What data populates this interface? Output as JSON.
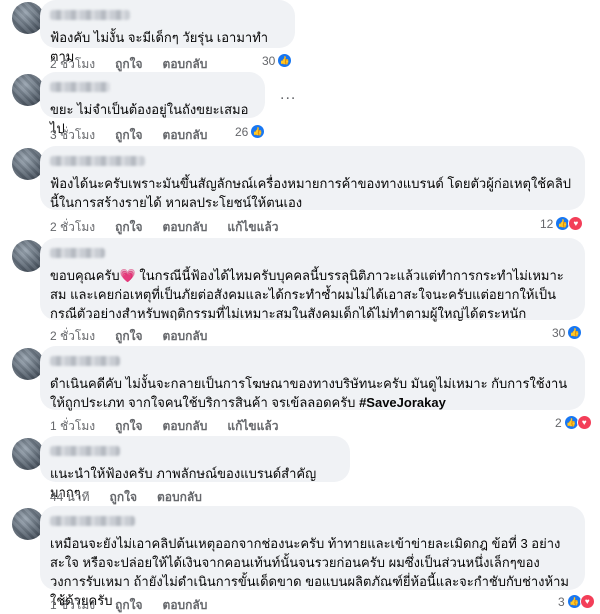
{
  "actions": {
    "like": "ถูกใจ",
    "reply": "ตอบกลับ",
    "translate": "แก้ไขแล้ว"
  },
  "comments": [
    {
      "text": "ฟ้องคับ ไม่งั้น จะมีเด็กๆ วัยรุ่น เอามาทำตาม",
      "time": "2 ชั่วโมง",
      "reactions": "30",
      "edited": false
    },
    {
      "text": "ขยะ ไม่จำเป็นต้องอยู่ในถังขยะเสมอไป",
      "time": "3 ชั่วโมง",
      "reactions": "26",
      "edited": false,
      "more": "..."
    },
    {
      "text": "ฟ้องได้นะครับเพราะมันขึ้นสัญลักษณ์เครื่องหมายการค้าของทางแบรนด์ โดยตัวผู้ก่อเหตุใช้คลิปนี้ในการสร้างรายได้ หาผลประโยชน์ให้ตนเอง",
      "time": "2 ชั่วโมง",
      "reactions": "12",
      "edited": true
    },
    {
      "text": "ขอบคุณครับ💗 ในกรณีนี้ฟ้องได้ไหมครับบุคคลนี้บรรลุนิติภาวะแล้วแต่ทำการกระทำไม่เหมาะสม และเคยก่อเหตุที่เป็นภัยต่อสังคมและได้กระทำซ้ำผมไม่ได้เอาสะใจนะครับแต่อยากให้เป็นกรณีตัวอย่างสำหรับพฤติกรรมที่ไม่เหมาะสมในสังคมเด็กได้ไม่ทำตามผู้ใหญ่ได้ตระหนัก",
      "time": "2 ชั่วโมง",
      "reactions": "30",
      "edited": false
    },
    {
      "text": "ดำเนินคดีคับ ไม่งั้นจะกลายเป็นการโฆษณาของทางบริษัทนะครับ มันดูไม่เหมาะ กับการใช้งานให้ถูกประเภท จากใจคนใช้บริการสินค้า จรเข้ลลอดครับ",
      "hashtag": "#SaveJorakay",
      "time": "1 ชั่วโมง",
      "reactions": "2",
      "edited": true
    },
    {
      "text": "แนะนำให้ฟ้องครับ ภาพลักษณ์ของแบรนด์สำคัญมากๆ",
      "time": "44 นาที",
      "reactions": "",
      "edited": false
    },
    {
      "text": "เหมือนจะยังไม่เอาคลิปต้นเหตุออกจากช่องนะครับ ท้าทายและเข้าข่ายละเมิดกฎ ข้อที่ 3 อย่างสะใจ หรือจะปล่อยให้ได้เงินจากคอนเท้นท์นั้นจนรวยก่อนครับ ผมซึ่งเป็นส่วนหนึ่งเล็กๆของวงการรับเหมา ถ้ายังไม่ดำเนินการขั้นเด็ดขาด ขอแบนผลิตภัณฑ์ยี่ห้อนี้และจะกำชับกับช่างห้ามใช้ด้วยครับ",
      "time": "1 ชั่วโมง",
      "reactions": "3",
      "edited": false
    }
  ]
}
